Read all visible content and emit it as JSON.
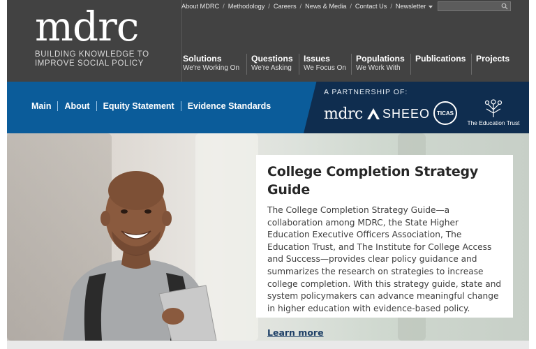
{
  "logo": {
    "word": "mdrc",
    "tagline_line1": "BUILDING KNOWLEDGE TO",
    "tagline_line2": "IMPROVE SOCIAL POLICY"
  },
  "utility_nav": [
    "About MDRC",
    "Methodology",
    "Careers",
    "News & Media",
    "Contact Us",
    "Newsletter"
  ],
  "search": {
    "placeholder": "",
    "icon": "search-icon"
  },
  "main_nav": [
    {
      "title": "Solutions",
      "subtitle": "We're Working On"
    },
    {
      "title": "Questions",
      "subtitle": "We're Asking"
    },
    {
      "title": "Issues",
      "subtitle": "We Focus On"
    },
    {
      "title": "Populations",
      "subtitle": "We Work With"
    },
    {
      "title": "Publications",
      "subtitle": ""
    },
    {
      "title": "Projects",
      "subtitle": ""
    }
  ],
  "sub_nav": [
    "Main",
    "About",
    "Equity Statement",
    "Evidence Standards"
  ],
  "partnership": {
    "label": "A PARTNERSHIP OF:",
    "partners": [
      "mdrc",
      "SHEEO",
      "TICAS",
      "The Education Trust"
    ]
  },
  "hero": {
    "title": "College Completion Strategy Guide",
    "body": "The College Completion Strategy Guide—a collaboration among MDRC, the State Higher Education Executive Officers Association, The Education Trust, and The Institute for College Access and Success—provides clear policy guidance and summarizes the research on strategies to increase college completion. With this strategy guide, state and system policymakers can advance meaningful change in higher education with evidence-based policy.",
    "link": "Learn more"
  },
  "colors": {
    "header_bg": "#424242",
    "band_blue": "#0b5c9a",
    "band_navy": "#0f2d4f",
    "link_color": "#1d3f66"
  }
}
